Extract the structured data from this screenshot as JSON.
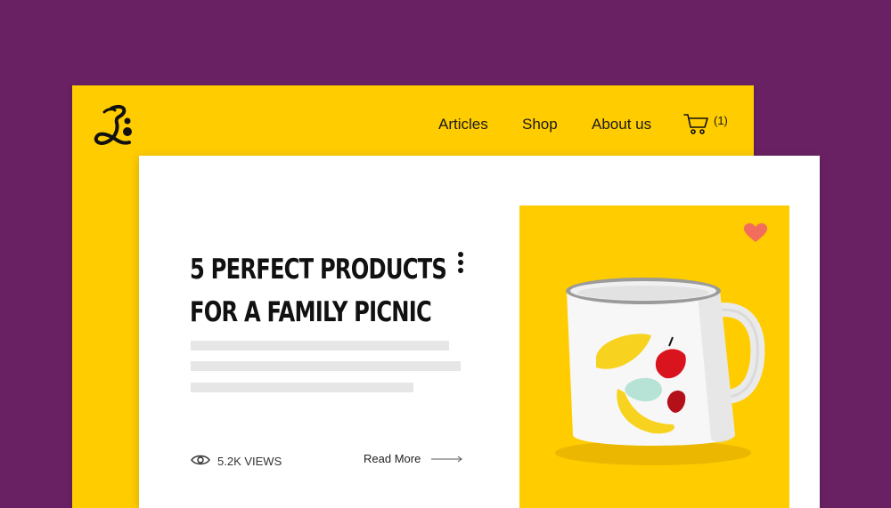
{
  "nav": {
    "items": [
      {
        "label": "Articles"
      },
      {
        "label": "Shop"
      },
      {
        "label": "About us"
      }
    ],
    "cart_count": "(1)"
  },
  "article": {
    "title_lines": [
      "5 PERFECT PRODUCTS",
      "FOR A FAMILY PICNIC"
    ],
    "views": "5.2K VIEWS",
    "read_more": "Read More"
  },
  "colors": {
    "background": "#6a2163",
    "accent": "#ffcc00",
    "heart": "#f26d5b"
  },
  "icons": [
    "logo-icon",
    "cart-icon",
    "more-icon",
    "eye-icon",
    "arrow-right-icon",
    "heart-icon"
  ]
}
